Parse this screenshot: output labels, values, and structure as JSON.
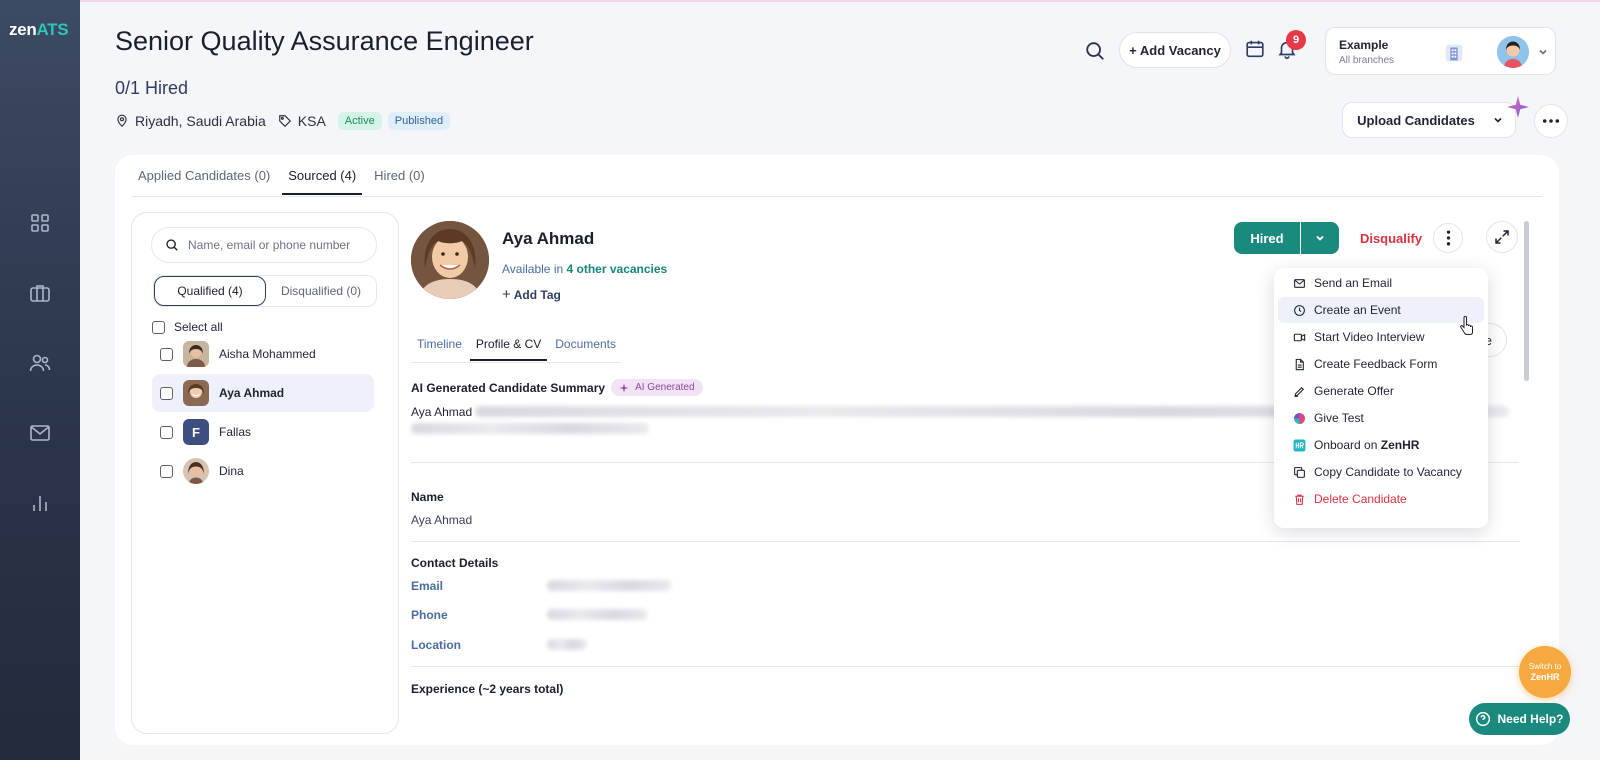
{
  "app": {
    "logo_main": "zen",
    "logo_accent": "ATS"
  },
  "sidebar": {
    "items": [
      {
        "name": "dashboard-grid-icon"
      },
      {
        "name": "briefcase-icon"
      },
      {
        "name": "users-icon"
      },
      {
        "name": "mail-icon"
      },
      {
        "name": "bar-chart-icon"
      }
    ]
  },
  "header": {
    "title": "Senior Quality Assurance Engineer",
    "hired_count": "0/1 Hired",
    "location": "Riyadh, Saudi Arabia",
    "tag": "KSA",
    "status_badge": "Active",
    "publish_badge": "Published",
    "add_vacancy_label": "+ Add Vacancy",
    "notifications_count": "9",
    "org": {
      "name": "Example",
      "sub": "All branches"
    },
    "upload_label": "Upload Candidates"
  },
  "tabs": [
    {
      "label": "Applied Candidates (0)"
    },
    {
      "label": "Sourced (4)"
    },
    {
      "label": "Hired (0)"
    }
  ],
  "candidate_list": {
    "search_placeholder": "Name, email or phone number",
    "filter_qualified": "Qualified (4)",
    "filter_disqualified": "Disqualified (0)",
    "select_all_label": "Select all",
    "items": [
      {
        "name": "Aisha Mohammed"
      },
      {
        "name": "Aya Ahmad"
      },
      {
        "name": "Fallas",
        "initial": "F"
      },
      {
        "name": "Dina"
      }
    ]
  },
  "candidate": {
    "name": "Aya Ahmad",
    "avail_prefix": "Available in",
    "avail_link": "4 other vacancies",
    "add_tag_label": "Add Tag",
    "hired_label": "Hired",
    "disqualify_label": "Disqualify",
    "profile_btn_label": "rofile",
    "detail_tabs": [
      {
        "label": "Timeline"
      },
      {
        "label": "Profile & CV"
      },
      {
        "label": "Documents"
      }
    ],
    "ai_summary_title": "AI Generated Candidate Summary",
    "ai_badge": "AI Generated",
    "summary_lead": "Aya Ahmad",
    "name_section": "Name",
    "name_value": "Aya Ahmad",
    "contact_section": "Contact Details",
    "email_label": "Email",
    "phone_label": "Phone",
    "location_label": "Location",
    "experience_section": "Experience (~2 years total)"
  },
  "action_menu": {
    "items": [
      {
        "label": "Send an Email",
        "icon": "mail-icon"
      },
      {
        "label": "Create an Event",
        "icon": "clock-icon"
      },
      {
        "label": "Start Video Interview",
        "icon": "video-icon"
      },
      {
        "label": "Create Feedback Form",
        "icon": "document-icon"
      },
      {
        "label": "Generate Offer",
        "icon": "pen-icon"
      },
      {
        "label": "Give Test",
        "icon": "test-logo-icon"
      },
      {
        "label_prefix": "Onboard on",
        "label_bold": "ZenHR",
        "icon": "zenhr-logo-icon"
      },
      {
        "label": "Copy Candidate to Vacancy",
        "icon": "copy-icon"
      },
      {
        "label": "Delete Candidate",
        "icon": "trash-icon"
      }
    ]
  },
  "floating": {
    "switch_line1": "Switch to",
    "switch_line2": "ZenHR",
    "need_help": "Need Help?"
  },
  "colors": {
    "primary": "#1b8a7e",
    "danger": "#d8333f",
    "sidebar": "#2a3348",
    "accent_orange": "#f7a941"
  }
}
